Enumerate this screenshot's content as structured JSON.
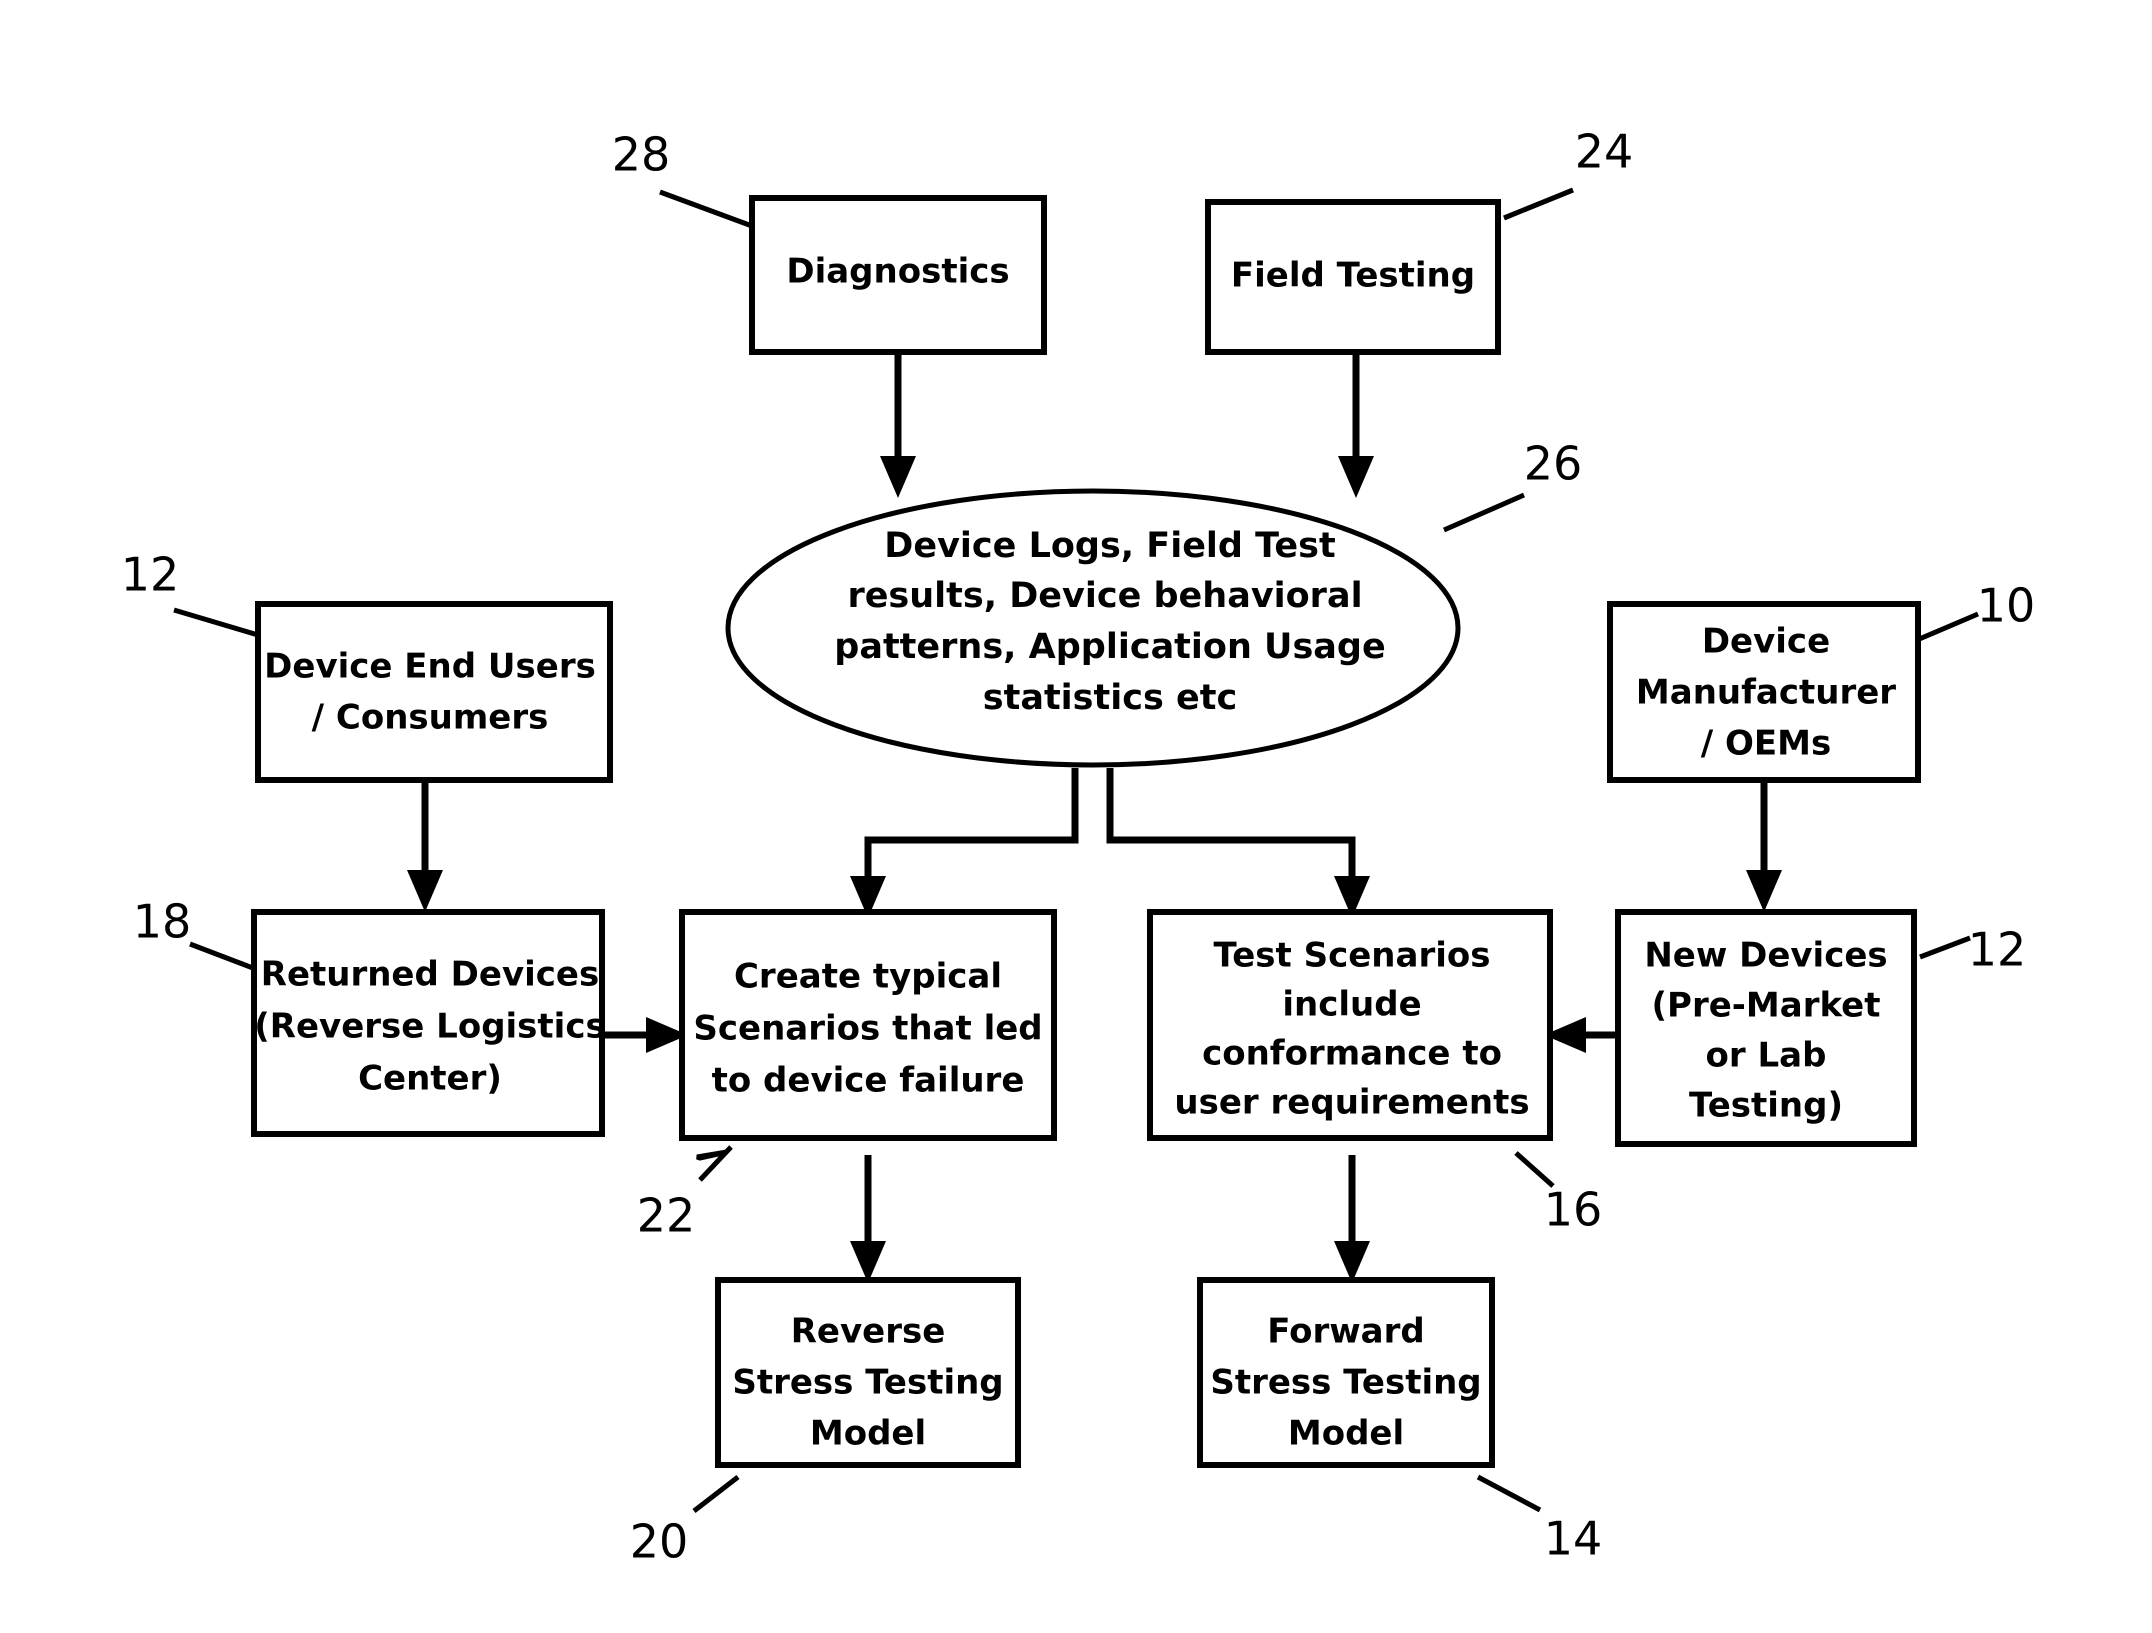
{
  "figure": {
    "type": "patent-flow-diagram",
    "background_color": "#ffffff",
    "line_color": "#000000"
  },
  "nodes": {
    "diagnostics": {
      "shape": "rectangle",
      "lines": [
        "Diagnostics"
      ],
      "ref": "28"
    },
    "field_testing": {
      "shape": "rectangle",
      "lines": [
        "Field Testing"
      ],
      "ref": "24"
    },
    "data_pool": {
      "shape": "ellipse",
      "lines": [
        "Device Logs, Field Test",
        "results, Device behavioral",
        "patterns, Application Usage",
        "statistics etc"
      ],
      "ref": "26"
    },
    "device_end_users": {
      "shape": "rectangle",
      "lines": [
        "Device End Users",
        "/ Consumers"
      ],
      "ref": "12"
    },
    "device_manufacturer": {
      "shape": "rectangle",
      "lines": [
        "Device",
        "Manufacturer",
        "/ OEMs"
      ],
      "ref": "10"
    },
    "returned_devices": {
      "shape": "rectangle",
      "lines": [
        "Returned Devices",
        "(Reverse Logistics",
        "Center)"
      ],
      "ref": "18"
    },
    "create_scenarios": {
      "shape": "rectangle",
      "lines": [
        "Create typical",
        "Scenarios that led",
        "to device failure"
      ],
      "ref": "22"
    },
    "test_scenarios": {
      "shape": "rectangle",
      "lines": [
        "Test Scenarios",
        "include",
        "conformance to",
        "user requirements"
      ],
      "ref": "16"
    },
    "new_devices": {
      "shape": "rectangle",
      "lines": [
        "New Devices",
        "(Pre-Market",
        "or Lab",
        "Testing)"
      ],
      "ref": "12"
    },
    "reverse_model": {
      "shape": "rectangle",
      "lines": [
        "Reverse",
        "Stress Testing",
        "Model"
      ],
      "ref": "20"
    },
    "forward_model": {
      "shape": "rectangle",
      "lines": [
        "Forward",
        "Stress Testing",
        "Model"
      ],
      "ref": "14"
    }
  },
  "reference_numerals": {
    "n28": "28",
    "n24": "24",
    "n26": "26",
    "n12_left": "12",
    "n10": "10",
    "n18": "18",
    "n22": "22",
    "n16": "16",
    "n12_right": "12",
    "n20": "20",
    "n14": "14"
  }
}
